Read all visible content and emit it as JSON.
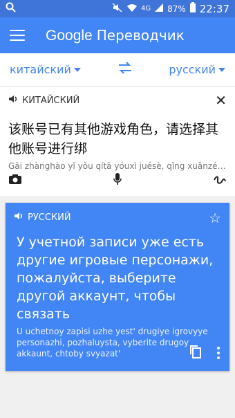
{
  "status": {
    "battery": "87%",
    "network": "4G",
    "time": "22:37"
  },
  "app": {
    "brand": "Google",
    "title": "Переводчик"
  },
  "languages": {
    "source": "китайский",
    "target": "русский"
  },
  "source": {
    "label": "КИТАЙСКИЙ",
    "text": "该账号已有其他游戏角色，请选择其他账号进行绑",
    "transliteration": "Gāi zhànghào yǐ yǒu qítā yóuxì juésè, qǐng xuǎnzé q..."
  },
  "result": {
    "label": "РУССКИЙ",
    "text": "У учетной записи уже есть другие игровые персонажи, пожалуйста, выберите другой аккаунт, чтобы связать",
    "transliteration": "U uchetnoy zapisi uzhe yest' drugiye igrovyye personazhi, pozhaluysta, vyberite drugoy akkaunt, chtoby svyazat'"
  },
  "icons": {
    "search": "search-icon",
    "menu": "menu-icon",
    "swap": "swap-icon",
    "close": "close-icon",
    "camera": "camera-icon",
    "mic": "mic-icon",
    "handwriting": "handwriting-icon",
    "speaker": "speaker-icon",
    "star": "star-icon",
    "copy": "copy-icon",
    "more": "more-icon"
  }
}
